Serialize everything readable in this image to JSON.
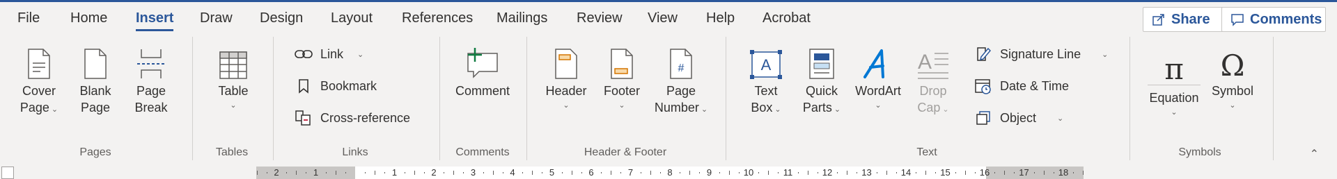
{
  "tabs": [
    "File",
    "Home",
    "Insert",
    "Draw",
    "Design",
    "Layout",
    "References",
    "Mailings",
    "Review",
    "View",
    "Help",
    "Acrobat"
  ],
  "active_tab": "Insert",
  "share_label": "Share",
  "comments_label": "Comments",
  "groups": {
    "pages": {
      "label": "Pages",
      "cover_page": [
        "Cover",
        "Page"
      ],
      "blank_page": [
        "Blank",
        "Page"
      ],
      "page_break": [
        "Page",
        "Break"
      ]
    },
    "tables": {
      "label": "Tables",
      "table": "Table"
    },
    "links": {
      "label": "Links",
      "link": "Link",
      "bookmark": "Bookmark",
      "cross_reference": "Cross-reference"
    },
    "comments": {
      "label": "Comments",
      "comment": "Comment"
    },
    "header_footer": {
      "label": "Header & Footer",
      "header": "Header",
      "footer": "Footer",
      "page_number": [
        "Page",
        "Number"
      ]
    },
    "text": {
      "label": "Text",
      "text_box": [
        "Text",
        "Box"
      ],
      "quick_parts": [
        "Quick",
        "Parts"
      ],
      "wordart": "WordArt",
      "drop_cap": [
        "Drop",
        "Cap"
      ],
      "signature_line": "Signature Line",
      "date_time": "Date & Time",
      "object": "Object"
    },
    "symbols": {
      "label": "Symbols",
      "equation": "Equation",
      "symbol": "Symbol"
    }
  },
  "ruler": {
    "left_numbers": [
      "2",
      "1"
    ],
    "right_numbers": [
      "1",
      "2",
      "3",
      "4",
      "5",
      "6",
      "7",
      "8",
      "9",
      "10",
      "11",
      "12",
      "13",
      "14",
      "15",
      "16",
      "17",
      "18"
    ]
  },
  "accent_color": "#2b579a",
  "icons": [
    "share-icon",
    "comments-icon",
    "cover-page-icon",
    "blank-page-icon",
    "page-break-icon",
    "table-icon",
    "link-icon",
    "bookmark-icon",
    "cross-reference-icon",
    "comment-icon",
    "header-icon",
    "footer-icon",
    "page-number-icon",
    "text-box-icon",
    "quick-parts-icon",
    "wordart-icon",
    "drop-cap-icon",
    "signature-line-icon",
    "date-time-icon",
    "object-icon",
    "equation-icon",
    "symbol-icon",
    "collapse-ribbon-icon"
  ]
}
